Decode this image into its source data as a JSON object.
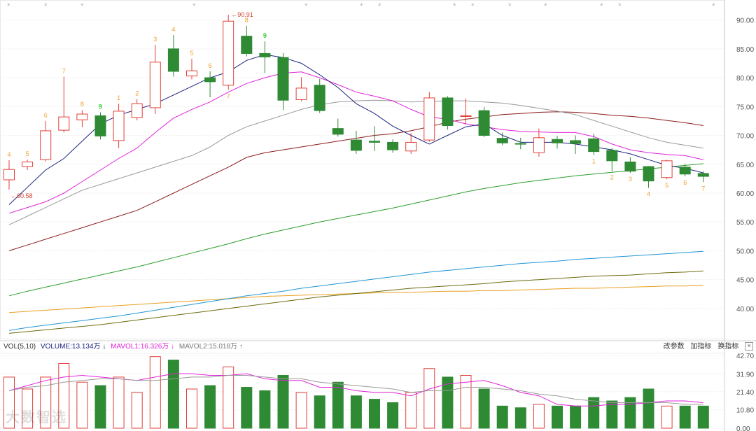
{
  "chart_data": {
    "type": "candlestick",
    "price_axis": {
      "ticks": [
        "90.00",
        "85.00",
        "80.00",
        "75.00",
        "70.00",
        "65.00",
        "60.00",
        "55.00",
        "50.00",
        "45.00",
        "40.00"
      ],
      "ylim": [
        35.5,
        92.5
      ]
    },
    "volume_axis": {
      "ticks": [
        "42.70",
        "31.90",
        "21.40",
        "10.80",
        "0.00"
      ],
      "ylim": [
        0,
        42.7
      ]
    },
    "candles": [
      {
        "o": 62.3,
        "h": 65.7,
        "l": 60.6,
        "c": 64.1,
        "label": "4"
      },
      {
        "o": 64.6,
        "h": 65.8,
        "l": 64.0,
        "c": 65.4,
        "label": "5"
      },
      {
        "o": 65.8,
        "h": 72.5,
        "l": 65.5,
        "c": 70.8,
        "label": "6"
      },
      {
        "o": 70.9,
        "h": 80.2,
        "l": 70.5,
        "c": 73.2,
        "label": "7"
      },
      {
        "o": 72.7,
        "h": 74.4,
        "l": 71.4,
        "c": 73.7,
        "label": "8"
      },
      {
        "o": 73.4,
        "h": 74.0,
        "l": 69.3,
        "c": 69.9,
        "label": "9"
      },
      {
        "o": 69.1,
        "h": 75.5,
        "l": 67.8,
        "c": 74.2,
        "label": "1"
      },
      {
        "o": 73.1,
        "h": 76.3,
        "l": 72.6,
        "c": 75.5,
        "label": "2"
      },
      {
        "o": 74.8,
        "h": 85.7,
        "l": 73.7,
        "c": 82.7,
        "label": "3"
      },
      {
        "o": 85.0,
        "h": 87.4,
        "l": 80.2,
        "c": 81.1,
        "label": "4"
      },
      {
        "o": 80.3,
        "h": 83.3,
        "l": 79.7,
        "c": 81.2,
        "label": "5"
      },
      {
        "o": 80.0,
        "h": 81.1,
        "l": 76.6,
        "c": 79.3,
        "label": "6"
      },
      {
        "o": 78.7,
        "h": 90.91,
        "l": 77.9,
        "c": 89.8,
        "label": "7"
      },
      {
        "o": 87.2,
        "h": 89.0,
        "l": 83.7,
        "c": 84.2,
        "label": "8"
      },
      {
        "o": 84.2,
        "h": 86.3,
        "l": 80.8,
        "c": 83.6,
        "label": "9"
      },
      {
        "o": 83.5,
        "h": 84.3,
        "l": 74.4,
        "c": 76.1,
        "label": ""
      },
      {
        "o": 76.2,
        "h": 80.1,
        "l": 75.9,
        "c": 78.2,
        "label": ""
      },
      {
        "o": 78.7,
        "h": 79.8,
        "l": 73.9,
        "c": 74.3,
        "label": ""
      },
      {
        "o": 71.2,
        "h": 72.9,
        "l": 69.8,
        "c": 70.2,
        "label": ""
      },
      {
        "o": 69.2,
        "h": 70.8,
        "l": 66.8,
        "c": 67.4,
        "label": ""
      },
      {
        "o": 69.0,
        "h": 71.6,
        "l": 67.3,
        "c": 68.8,
        "label": ""
      },
      {
        "o": 68.8,
        "h": 69.3,
        "l": 67.0,
        "c": 67.5,
        "label": ""
      },
      {
        "o": 67.3,
        "h": 70.4,
        "l": 66.8,
        "c": 68.8,
        "label": ""
      },
      {
        "o": 69.2,
        "h": 77.5,
        "l": 68.9,
        "c": 76.5,
        "label": ""
      },
      {
        "o": 76.5,
        "h": 76.8,
        "l": 71.0,
        "c": 71.7,
        "label": ""
      },
      {
        "o": 73.3,
        "h": 76.4,
        "l": 71.9,
        "c": 73.4,
        "label": ""
      },
      {
        "o": 74.3,
        "h": 74.9,
        "l": 69.7,
        "c": 70.0,
        "label": ""
      },
      {
        "o": 69.5,
        "h": 70.5,
        "l": 68.3,
        "c": 68.7,
        "label": ""
      },
      {
        "o": 68.6,
        "h": 69.6,
        "l": 67.6,
        "c": 68.5,
        "label": ""
      },
      {
        "o": 67.0,
        "h": 71.2,
        "l": 66.3,
        "c": 69.6,
        "label": ""
      },
      {
        "o": 69.3,
        "h": 69.9,
        "l": 67.7,
        "c": 68.7,
        "label": ""
      },
      {
        "o": 69.1,
        "h": 70.0,
        "l": 66.8,
        "c": 68.6,
        "label": ""
      },
      {
        "o": 69.4,
        "h": 70.3,
        "l": 66.6,
        "c": 67.2,
        "label": "1"
      },
      {
        "o": 67.4,
        "h": 67.8,
        "l": 63.8,
        "c": 65.6,
        "label": "2"
      },
      {
        "o": 65.4,
        "h": 66.2,
        "l": 63.5,
        "c": 63.8,
        "label": "3"
      },
      {
        "o": 64.6,
        "h": 64.7,
        "l": 60.9,
        "c": 62.1,
        "label": "4"
      },
      {
        "o": 62.7,
        "h": 65.8,
        "l": 62.4,
        "c": 65.6,
        "label": "5"
      },
      {
        "o": 64.5,
        "h": 65.1,
        "l": 62.9,
        "c": 63.3,
        "label": "6"
      },
      {
        "o": 63.4,
        "h": 63.8,
        "l": 61.9,
        "c": 62.9,
        "label": "7"
      }
    ],
    "volume": [
      30,
      23,
      30,
      38,
      27,
      25,
      30,
      21,
      42,
      40,
      23,
      25,
      36,
      24,
      22,
      31,
      21,
      19,
      27,
      19,
      17,
      15,
      21,
      35,
      30,
      31,
      23,
      13,
      12,
      14,
      13,
      13,
      18,
      16,
      18,
      23,
      13,
      13,
      13
    ],
    "annotations": {
      "high": "90.91",
      "low": "60.58"
    },
    "ma_lines": {
      "ma_navy": [
        58,
        61,
        64,
        66,
        69,
        72,
        73.5,
        74.5,
        75.5,
        77,
        78.5,
        80,
        81,
        83,
        84,
        83.5,
        82.5,
        80.5,
        78.3,
        75.5,
        73.8,
        71.6,
        70,
        68.5,
        70,
        71.5,
        72,
        70,
        68.8,
        68.8,
        68.8,
        68.5,
        68,
        67.5,
        66.8,
        65.8,
        64.8,
        64.3,
        63.5
      ],
      "ma_magenta": [
        56.5,
        57.5,
        58.5,
        60,
        62,
        64,
        66,
        67.8,
        70.5,
        73,
        74.5,
        75.8,
        77.5,
        79,
        80,
        80.8,
        81,
        80,
        78.8,
        77.5,
        76.8,
        76,
        74.5,
        73.2,
        72.8,
        72,
        71.5,
        71,
        70.7,
        70.6,
        70.5,
        70.5,
        69.8,
        68.5,
        67.5,
        67,
        66.7,
        66.5,
        65.8
      ],
      "ma_gray": [
        54.5,
        56,
        57.5,
        59,
        60.5,
        61.5,
        62.5,
        63.5,
        64.5,
        65.5,
        66.5,
        68,
        70,
        71.5,
        72.5,
        73.5,
        74.5,
        75.3,
        75.8,
        76,
        76.1,
        76,
        75.8,
        75.9,
        76,
        76,
        75.8,
        75.6,
        75.2,
        74.7,
        74.2,
        73.6,
        72.6,
        71.6,
        70.6,
        69.6,
        68.8,
        68.3,
        67.8
      ],
      "ma_darkred": [
        50,
        51,
        52,
        53,
        54,
        55,
        56,
        57,
        58.5,
        60,
        61.5,
        63,
        64.5,
        66.2,
        67,
        67.5,
        68,
        68.5,
        69,
        69.5,
        70,
        70.3,
        70.8,
        71.5,
        72.3,
        72.8,
        73.2,
        73.6,
        73.8,
        74,
        74.1,
        74,
        73.8,
        73.5,
        73.3,
        73,
        72.6,
        72.2,
        71.7
      ],
      "ma_green": [
        42.2,
        43,
        43.7,
        44.4,
        45.1,
        45.8,
        46.5,
        47.2,
        48,
        48.8,
        49.6,
        50.4,
        51.2,
        52.1,
        52.9,
        53.6,
        54.3,
        55,
        55.6,
        56.2,
        56.8,
        57.4,
        58.1,
        58.8,
        59.5,
        60.2,
        60.8,
        61.3,
        61.8,
        62.2,
        62.6,
        63,
        63.3,
        63.6,
        63.9,
        64.2,
        64.5,
        64.8,
        65.1
      ],
      "ma_blue": [
        36.2,
        36.7,
        37.1,
        37.5,
        37.9,
        38.3,
        38.7,
        39.2,
        39.7,
        40.2,
        40.7,
        41.2,
        41.7,
        42.2,
        42.6,
        43,
        43.5,
        43.9,
        44.3,
        44.7,
        45.1,
        45.5,
        45.9,
        46.3,
        46.6,
        46.9,
        47.2,
        47.5,
        47.8,
        48,
        48.2,
        48.5,
        48.7,
        48.9,
        49.1,
        49.3,
        49.5,
        49.7,
        49.9
      ],
      "ma_olive": [
        35.7,
        36,
        36.3,
        36.6,
        36.9,
        37.2,
        37.6,
        38,
        38.4,
        38.8,
        39.2,
        39.6,
        40,
        40.4,
        40.8,
        41.2,
        41.6,
        42,
        42.3,
        42.6,
        42.9,
        43.2,
        43.5,
        43.7,
        43.9,
        44.1,
        44.3,
        44.6,
        44.8,
        45,
        45.2,
        45.4,
        45.6,
        45.7,
        45.8,
        46,
        46.2,
        46.3,
        46.5
      ],
      "ma_orange": [
        39.3,
        39.5,
        39.7,
        39.9,
        40.1,
        40.3,
        40.5,
        40.7,
        40.9,
        41.1,
        41.3,
        41.5,
        41.7,
        41.9,
        42.1,
        42.2,
        42.3,
        42.4,
        42.5,
        42.6,
        42.7,
        42.8,
        42.8,
        42.9,
        43,
        43,
        43.1,
        43.1,
        43.2,
        43.3,
        43.4,
        43.5,
        43.5,
        43.6,
        43.7,
        43.8,
        43.9,
        43.9,
        44
      ]
    },
    "vol_ma": {
      "mavol1": [
        22,
        25,
        28,
        30,
        31,
        30,
        29,
        28,
        30,
        32,
        32,
        31,
        31,
        32,
        29,
        28,
        28,
        24,
        24,
        22,
        21,
        21,
        19,
        23,
        26,
        27,
        28,
        25,
        21,
        19,
        14,
        13,
        13,
        14,
        14,
        15,
        16,
        16,
        15
      ],
      "mavol2": [
        22,
        24,
        25,
        27,
        28,
        29,
        29,
        28,
        28,
        29,
        30,
        30,
        31,
        31,
        30,
        29,
        29,
        27,
        26,
        25,
        24,
        23,
        21,
        22,
        22,
        24,
        24,
        23,
        22,
        20,
        19,
        17,
        16,
        15,
        15,
        15,
        15,
        14,
        14
      ]
    },
    "colors": {
      "up": "#e0403a",
      "down": "#2f8a34",
      "ma_navy": "#1a237e",
      "ma_magenta": "#e023d8",
      "ma_gray": "#9a9a9a",
      "ma_darkred": "#8b1a1a",
      "ma_green": "#2e9e2e",
      "ma_blue": "#2196d3",
      "ma_olive": "#6b6b10",
      "ma_orange": "#e8a020"
    }
  },
  "vol_header": {
    "title": "VOL(5,10)",
    "volume": "VOLUME:13.134万",
    "mavol1": "MAVOL1:16.326万",
    "mavol2": "MAVOL2:15.018万",
    "btn_params": "改参数",
    "btn_add": "加指标",
    "btn_switch": "换指标",
    "close": "×"
  },
  "watermark": "大数智选"
}
